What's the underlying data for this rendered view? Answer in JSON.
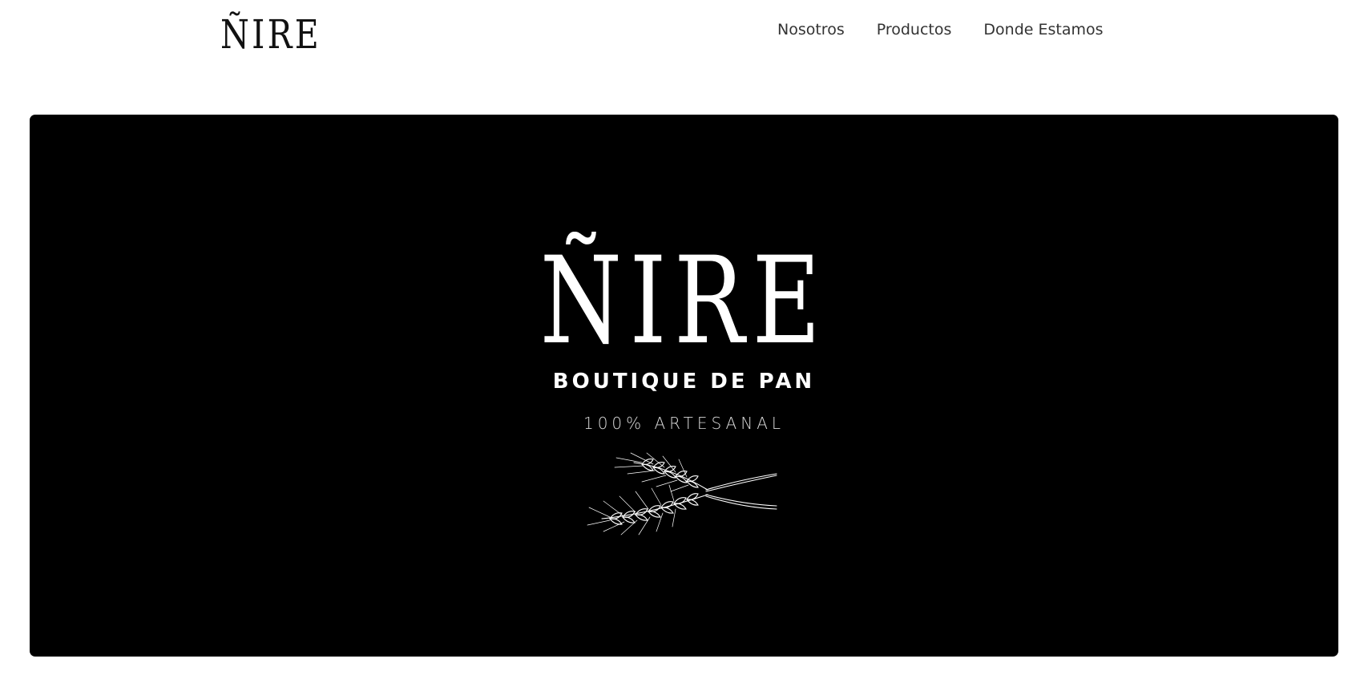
{
  "nav": {
    "brand": "ÑIRE",
    "links": [
      {
        "label": "Nosotros"
      },
      {
        "label": "Productos"
      },
      {
        "label": "Donde Estamos"
      }
    ]
  },
  "hero": {
    "title": "ÑIRE",
    "subtitle": "BOUTIQUE DE PAN",
    "tagline": "100% ARTESANAL",
    "illustration_icon": "wheat-ears-icon",
    "background_color": "#000000",
    "text_color": "#ffffff"
  }
}
